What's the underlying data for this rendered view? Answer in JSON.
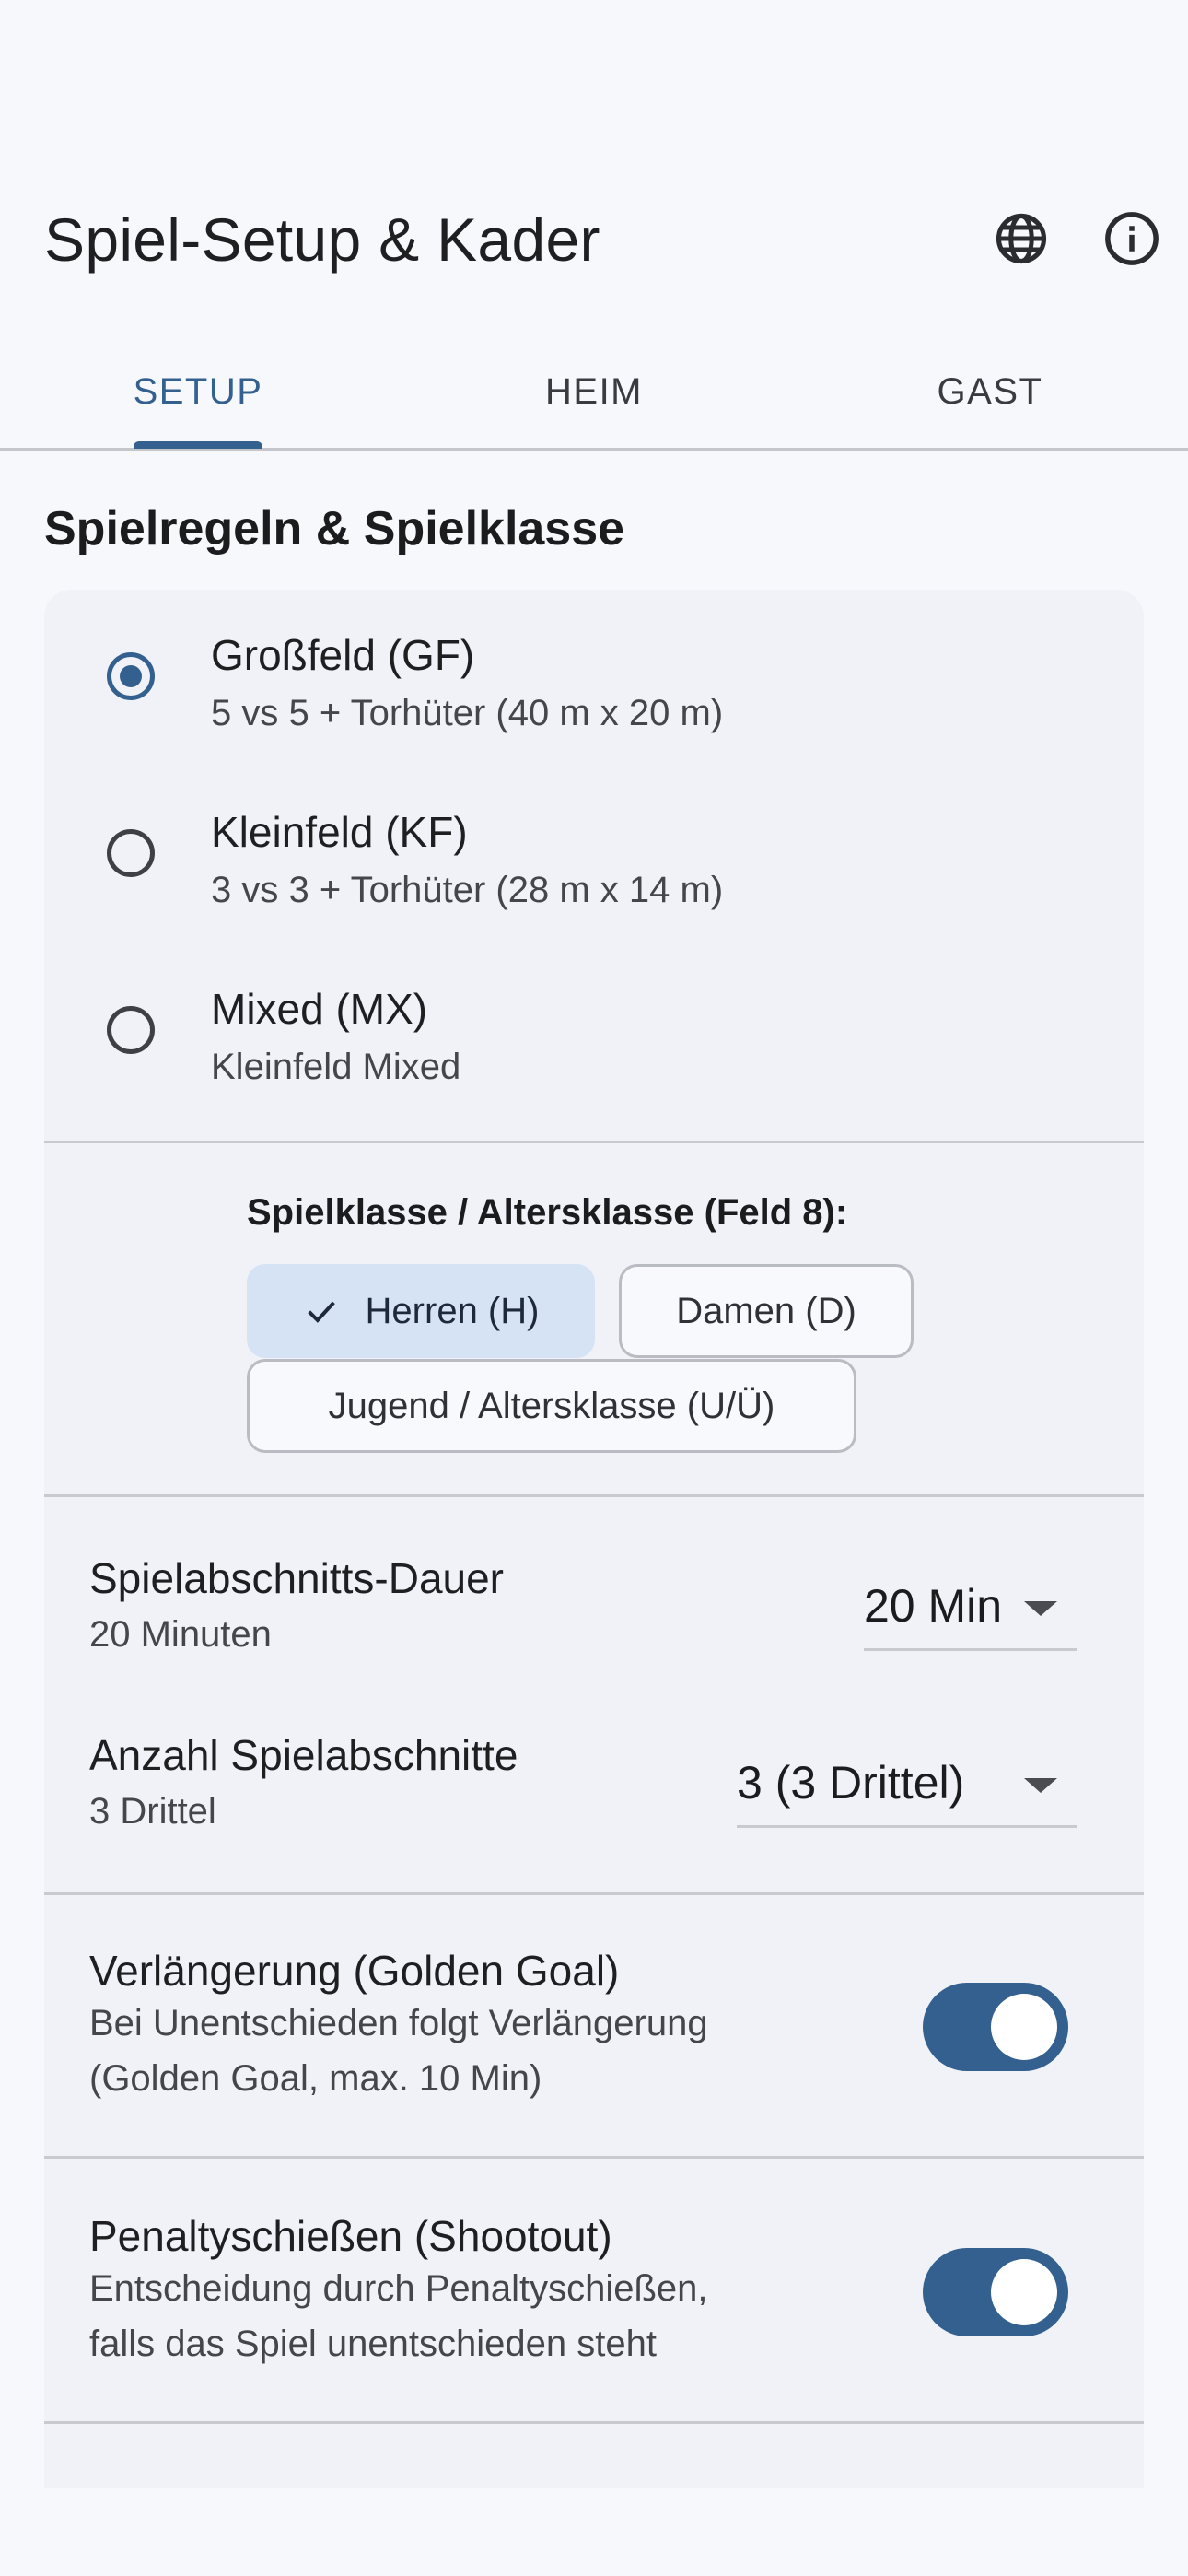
{
  "app_bar": {
    "title": "Spiel-Setup & Kader"
  },
  "icons": {
    "globe": "globe-icon",
    "info": "info-icon",
    "check": "check-icon"
  },
  "tabs": [
    {
      "label": "SETUP",
      "selected": true
    },
    {
      "label": "HEIM",
      "selected": false
    },
    {
      "label": "GAST",
      "selected": false
    }
  ],
  "section": {
    "title": "Spielregeln & Spielklasse"
  },
  "field_modes": [
    {
      "title": "Großfeld (GF)",
      "subtitle": "5 vs 5 + Torhüter (40 m x 20 m)",
      "checked": true
    },
    {
      "title": "Kleinfeld (KF)",
      "subtitle": "3 vs 3 + Torhüter (28 m x 14 m)",
      "checked": false
    },
    {
      "title": "Mixed (MX)",
      "subtitle": "Kleinfeld Mixed",
      "checked": false
    }
  ],
  "class_group": {
    "label": "Spielklasse / Altersklasse (Feld 8):",
    "chips": [
      {
        "label": "Herren (H)",
        "selected": true
      },
      {
        "label": "Damen (D)",
        "selected": false
      },
      {
        "label": "Jugend / Altersklasse (U/Ü)",
        "selected": false
      }
    ]
  },
  "duration": {
    "title": "Spielabschnitts-Dauer",
    "subtitle": "20 Minuten",
    "value": "20 Min"
  },
  "periods": {
    "title": "Anzahl Spielabschnitte",
    "subtitle": "3 Drittel",
    "value": "3 (3 Drittel)"
  },
  "overtime": {
    "title": "Verlängerung (Golden Goal)",
    "subtitle_line1": "Bei Unentschieden folgt Verlängerung",
    "subtitle_line2": "(Golden Goal, max. 10 Min)",
    "enabled": true
  },
  "shootout": {
    "title": "Penaltyschießen (Shootout)",
    "subtitle_line1": "Entscheidung durch Penaltyschießen,",
    "subtitle_line2": "falls das Spiel unentschieden steht",
    "enabled": true
  },
  "colors": {
    "accent": "#33608f",
    "chip_selected": "#d6e3f5",
    "card": "#f0f2f8",
    "background": "#f7f8fc"
  }
}
